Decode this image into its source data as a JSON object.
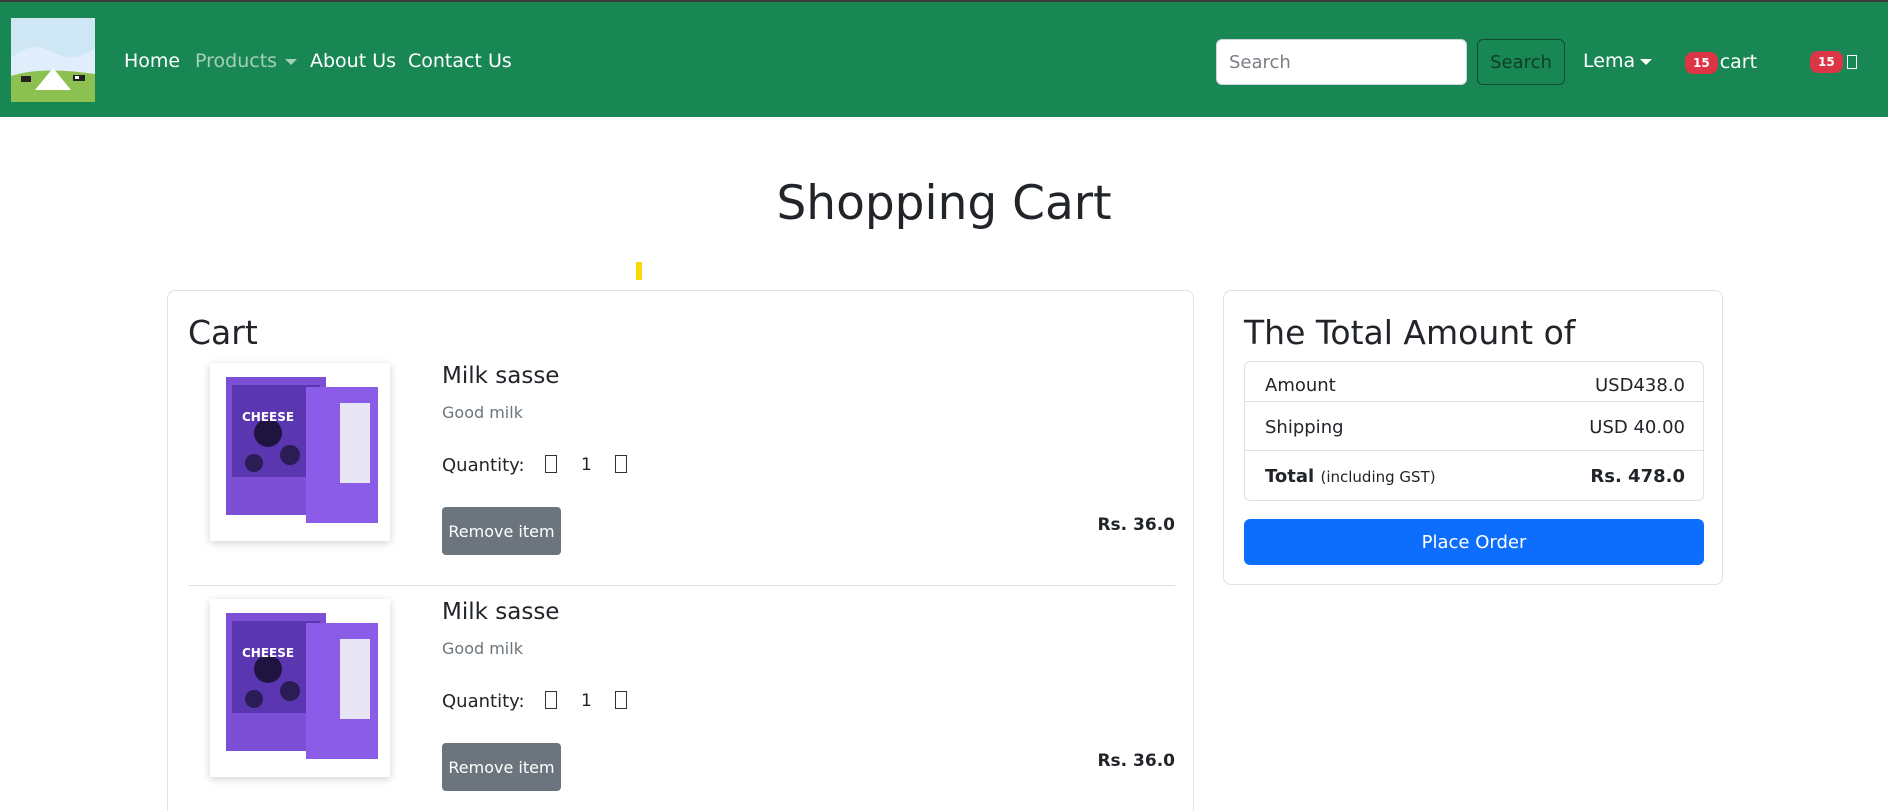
{
  "nav": {
    "home": "Home",
    "products": "Products",
    "about": "About Us",
    "contact": "Contact Us",
    "search_placeholder": "Search",
    "search_button": "Search",
    "user": "Lema",
    "cart_count": "15",
    "cart_label": "cart",
    "cart_icon_count": "15"
  },
  "page": {
    "title": "Shopping Cart"
  },
  "cart": {
    "heading": "Cart",
    "items": [
      {
        "name": "Milk sasse",
        "description": "Good milk",
        "quantity_label": "Quantity:",
        "quantity": "1",
        "remove_label": "Remove item",
        "price": "Rs. 36.0"
      },
      {
        "name": "Milk sasse",
        "description": "Good milk",
        "quantity_label": "Quantity:",
        "quantity": "1",
        "remove_label": "Remove item",
        "price": "Rs. 36.0"
      }
    ]
  },
  "summary": {
    "title": "The Total Amount of",
    "amount_label": "Amount",
    "amount_value": "USD438.0",
    "shipping_label": "Shipping",
    "shipping_value": "USD 40.00",
    "total_label": "Total",
    "total_note": "(including GST)",
    "total_value": "Rs. 478.0",
    "place_order": "Place Order"
  },
  "colors": {
    "navbar": "#198754",
    "badge": "#dc3545",
    "primary": "#0d6efd",
    "secondary": "#6c757d"
  }
}
